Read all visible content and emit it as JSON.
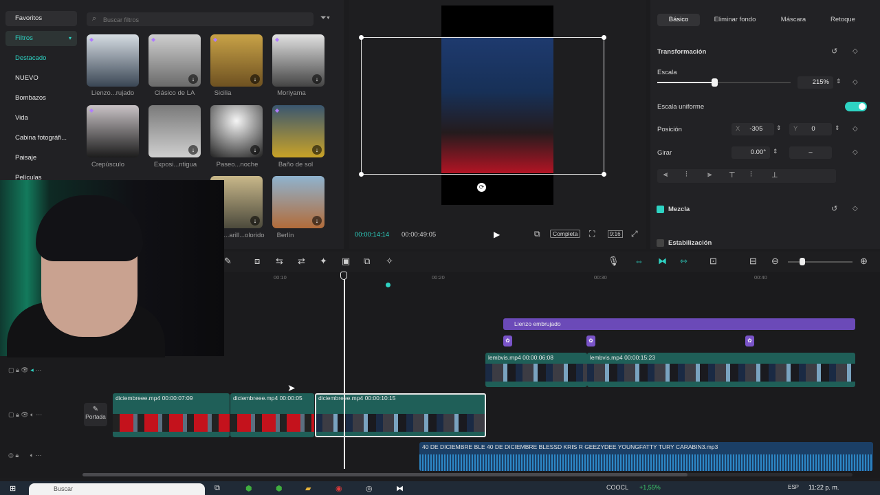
{
  "left_panel": {
    "categories": [
      {
        "label": "Favoritos"
      },
      {
        "label": "Filtros"
      },
      {
        "label": "Destacado"
      },
      {
        "label": "NUEVO"
      },
      {
        "label": "Bombazos"
      },
      {
        "label": "Vida"
      },
      {
        "label": "Cabina fotográfi..."
      },
      {
        "label": "Paisaje"
      },
      {
        "label": "Películas"
      }
    ],
    "search_placeholder": "Buscar filtros",
    "filters": [
      {
        "label": "Lienzo...rujado"
      },
      {
        "label": "Clásico de LA"
      },
      {
        "label": "Sicilia"
      },
      {
        "label": "Moriyama"
      },
      {
        "label": "Crepúsculo"
      },
      {
        "label": "Exposi...ntigua"
      },
      {
        "label": "Paseo...noche"
      },
      {
        "label": "Baño de sol"
      },
      {
        "label": "...arill...olorido"
      },
      {
        "label": "Berlín"
      }
    ]
  },
  "player": {
    "current_time": "00:00:14:14",
    "total_time": "00:00:49:05",
    "ratio_label": "Completa"
  },
  "right_panel": {
    "tabs": [
      "Básico",
      "Eliminar fondo",
      "Máscara",
      "Retoque"
    ],
    "transform_title": "Transformación",
    "scale_label": "Escala",
    "scale_value": "215%",
    "scale_fraction": 0.43,
    "uniform_label": "Escala uniforme",
    "position_label": "Posición",
    "pos_x_label": "X",
    "pos_x": "-305",
    "pos_y_label": "Y",
    "pos_y": "0",
    "rotate_label": "Girar",
    "rotate_value": "0.00°",
    "rotate_dash": "–",
    "blend_label": "Mezcla",
    "stabilize_label": "Estabilización"
  },
  "timeline": {
    "ruler": [
      "00:10",
      "00:20",
      "00:30",
      "00:40"
    ],
    "portada_label": "Portada",
    "text_clip": "Lienzo embrujado",
    "clips_main": [
      {
        "name": "diciembreee.mp4",
        "duration": "00:00:07:09"
      },
      {
        "name": "diciembreee.mp4",
        "duration": "00:00:05"
      },
      {
        "name": "diciembreee.mp4",
        "duration": "00:00:10:15"
      }
    ],
    "clips_overlay": [
      {
        "name": "lembvis.mp4",
        "duration": "00:00:06:08"
      },
      {
        "name": "lembvis.mp4",
        "duration": "00:00:15:23"
      }
    ],
    "audio_a": "40 DE DICIEMBRE  BLE",
    "audio_b": "40 DE DICIEMBRE  BLESSD  KRIS R  GEEZYDEE  YOUNGFATTY  TURY  CARABIN3.mp3"
  },
  "taskbar": {
    "search": "Buscar",
    "weather": "COOCL",
    "index": "+1,55%",
    "lang": "ESP",
    "clock": "11:22 p. m."
  },
  "colors": {
    "accent": "#2ed3c3",
    "purple": "#6b4ab8",
    "audio": "#1b3f66"
  }
}
